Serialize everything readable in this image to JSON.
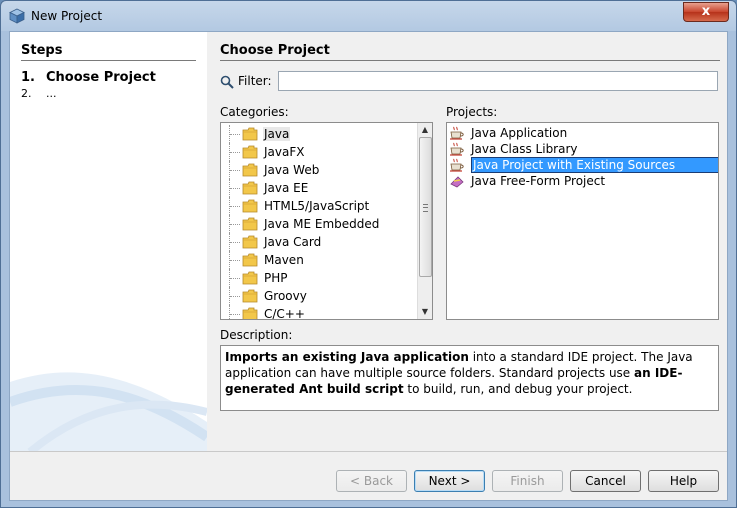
{
  "window": {
    "title": "New Project",
    "close_label": "x"
  },
  "steps": {
    "title": "Steps",
    "items": [
      {
        "num": "1.",
        "label": "Choose Project"
      },
      {
        "num": "2.",
        "label": "..."
      }
    ]
  },
  "main": {
    "title": "Choose Project",
    "filter_label": "Filter:",
    "filter_value": "",
    "categories_label": "Categories:",
    "projects_label": "Projects:",
    "description_label": "Description:"
  },
  "categories": [
    {
      "label": "Java",
      "selected": true
    },
    {
      "label": "JavaFX"
    },
    {
      "label": "Java Web"
    },
    {
      "label": "Java EE"
    },
    {
      "label": "HTML5/JavaScript"
    },
    {
      "label": "Java ME Embedded"
    },
    {
      "label": "Java Card"
    },
    {
      "label": "Maven"
    },
    {
      "label": "PHP"
    },
    {
      "label": "Groovy"
    },
    {
      "label": "C/C++"
    }
  ],
  "projects": [
    {
      "label": "Java Application",
      "icon": "coffee-cup-icon"
    },
    {
      "label": "Java Class Library",
      "icon": "coffee-cup-icon"
    },
    {
      "label": "Java Project with Existing Sources",
      "icon": "coffee-cup-icon",
      "selected": true
    },
    {
      "label": "Java Free-Form Project",
      "icon": "free-form-icon"
    }
  ],
  "description": {
    "bold1": "Imports an existing Java application",
    "text1": " into a standard IDE project. The Java application can have multiple source folders. Standard projects use ",
    "bold2": "an IDE-generated Ant build script",
    "text2": " to build, run, and debug your project."
  },
  "buttons": {
    "back": "< Back",
    "next": "Next >",
    "finish": "Finish",
    "cancel": "Cancel",
    "help": "Help"
  },
  "colors": {
    "selection": "#3399ff",
    "titlebar": "#b3c9e2"
  }
}
